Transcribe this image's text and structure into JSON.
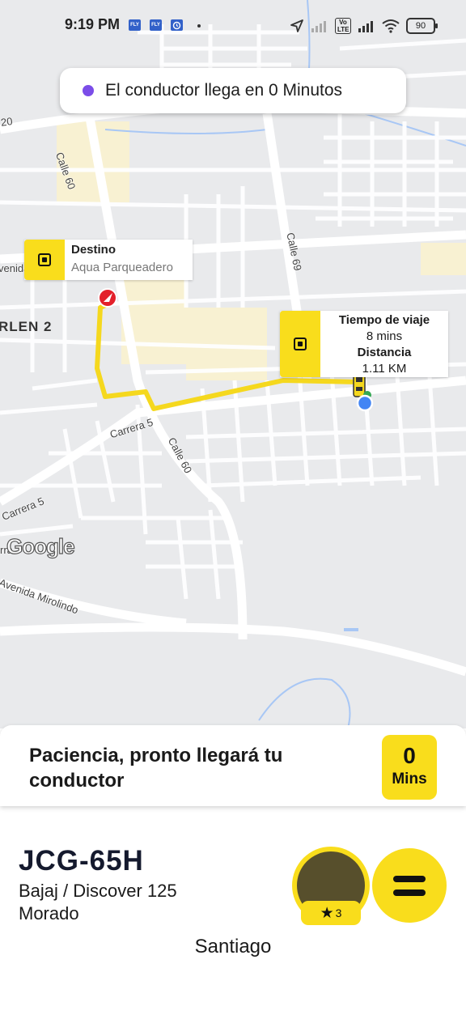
{
  "status_bar": {
    "time": "9:19 PM",
    "notification_icons": [
      "FLY",
      "FLY",
      "alarm"
    ],
    "network_label": "Vo LTE",
    "battery": "90"
  },
  "eta_banner": {
    "text": "El conductor llega en 0 Minutos",
    "dot_color": "#7b4de8"
  },
  "map": {
    "streets": [
      "Calle 60",
      "Calle 69",
      "Carrera 5",
      "Calle 60",
      "Carrera 5",
      "Avenida Mirolindo",
      "venida",
      "20",
      "rra"
    ],
    "district": "RLEN 2",
    "attribution": "Google"
  },
  "destination": {
    "title": "Destino",
    "address": "Aqua Parqueadero"
  },
  "trip_info": {
    "time_label": "Tiempo de viaje",
    "time_value": "8 mins",
    "distance_label": "Distancia",
    "distance_value": "1.11 KM"
  },
  "wait_card": {
    "message": "Paciencia, pronto llegará tu conductor",
    "minutes": "0",
    "minutes_unit": "Mins"
  },
  "driver": {
    "plate": "JCG-65H",
    "vehicle": "Bajaj / Discover 125",
    "color": "Morado",
    "name": "Santiago",
    "rating": "3"
  },
  "colors": {
    "accent": "#f9dd1c",
    "route": "#f5d81e",
    "map_bg": "#e9eaec"
  }
}
